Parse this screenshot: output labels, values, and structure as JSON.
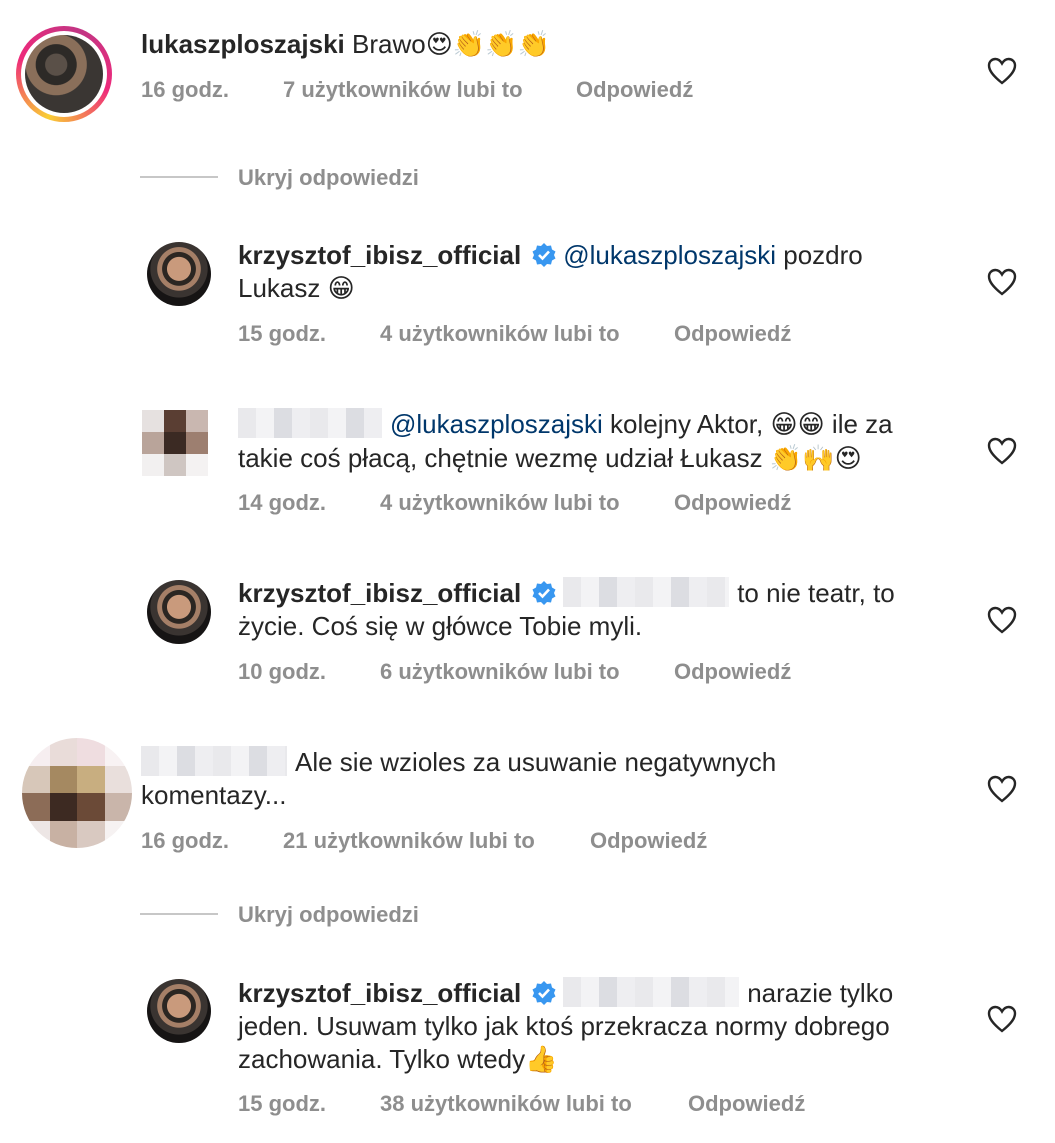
{
  "comments": [
    {
      "username": "lukaszploszajski",
      "text": " Brawo",
      "emoji": "😍👏👏👏",
      "time": "16 godz.",
      "likes": "7 użytkowników lubi to",
      "reply": "Odpowiedź"
    },
    {
      "username": "krzysztof_ibisz_official",
      "mention": "@lukaszploszajski",
      "text": " pozdro",
      "line2": "Lukasz ",
      "emoji": "😁",
      "time": "15 godz.",
      "likes": "4 użytkowników lubi to",
      "reply": "Odpowiedź"
    },
    {
      "mention": "@lukaszploszajski",
      "text": " kolejny Aktor, ",
      "emoji1": "😁😁",
      "text2": " ile za",
      "line2": "takie coś płacą, chętnie wezmę udział Łukasz ",
      "emoji2": "👏🙌😍",
      "time": "14 godz.",
      "likes": "4 użytkowników lubi to",
      "reply": "Odpowiedź"
    },
    {
      "username": "krzysztof_ibisz_official",
      "text": "to nie teatr, to",
      "line2": "życie. Coś się w główce Tobie myli.",
      "time": "10 godz.",
      "likes": "6 użytkowników lubi to",
      "reply": "Odpowiedź"
    },
    {
      "text": "Ale sie wzioles za usuwanie negatywnych",
      "line2": "komentazy...",
      "time": "16 godz.",
      "likes": "21 użytkowników lubi to",
      "reply": "Odpowiedź"
    },
    {
      "username": "krzysztof_ibisz_official",
      "text": "narazie tylko",
      "line2": "jeden. Usuwam tylko jak ktoś przekracza normy dobrego",
      "line3": "zachowania. Tylko wtedy",
      "emoji": "👍",
      "time": "15 godz.",
      "likes": "38 użytkowników lubi to",
      "reply": "Odpowiedź"
    }
  ],
  "hide_replies": "Ukryj odpowiedzi",
  "colors": {
    "text": "#262626",
    "meta": "#8e8e8e",
    "mention": "#00376b",
    "verified": "#3897f0"
  }
}
